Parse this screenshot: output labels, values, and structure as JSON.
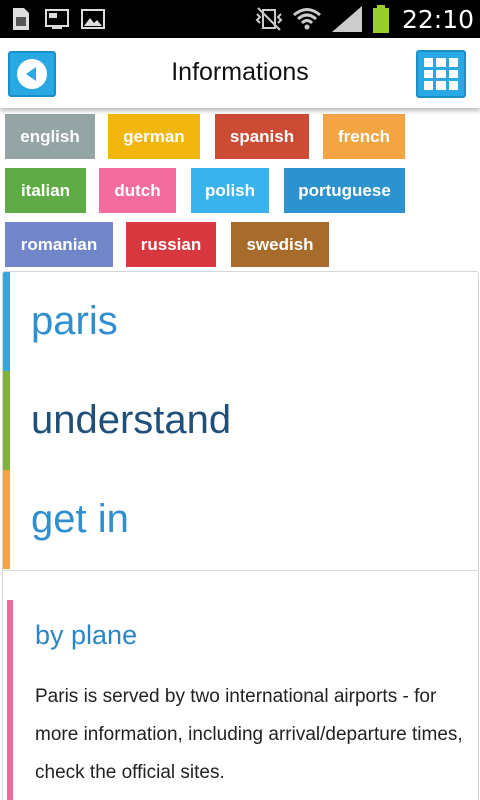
{
  "status_bar": {
    "time": "22:10"
  },
  "header": {
    "title": "Informations"
  },
  "languages": [
    {
      "label": "english",
      "color": "#95a5a6"
    },
    {
      "label": "german",
      "color": "#f1b70f"
    },
    {
      "label": "spanish",
      "color": "#cb4b35"
    },
    {
      "label": "french",
      "color": "#f3a443"
    },
    {
      "label": "italian",
      "color": "#5fac46"
    },
    {
      "label": "dutch",
      "color": "#f46c9e"
    },
    {
      "label": "polish",
      "color": "#3ab3ec"
    },
    {
      "label": "portuguese",
      "color": "#2c93cf"
    },
    {
      "label": "romanian",
      "color": "#7086c8"
    },
    {
      "label": "russian",
      "color": "#d7383f"
    },
    {
      "label": "swedish",
      "color": "#a76b2c"
    }
  ],
  "sections": [
    {
      "label": "paris",
      "bar_color": "#35a7dd",
      "text_color": "#2f8fcf"
    },
    {
      "label": "understand",
      "bar_color": "#7fb33c",
      "text_color": "#20507a"
    },
    {
      "label": "get in",
      "bar_color": "#f4a73f",
      "text_color": "#2f8fcf"
    }
  ],
  "subsection": {
    "title": "by plane",
    "text": "Paris is served by two international airports - for more information, including arrival/departure times, check the official sites."
  }
}
